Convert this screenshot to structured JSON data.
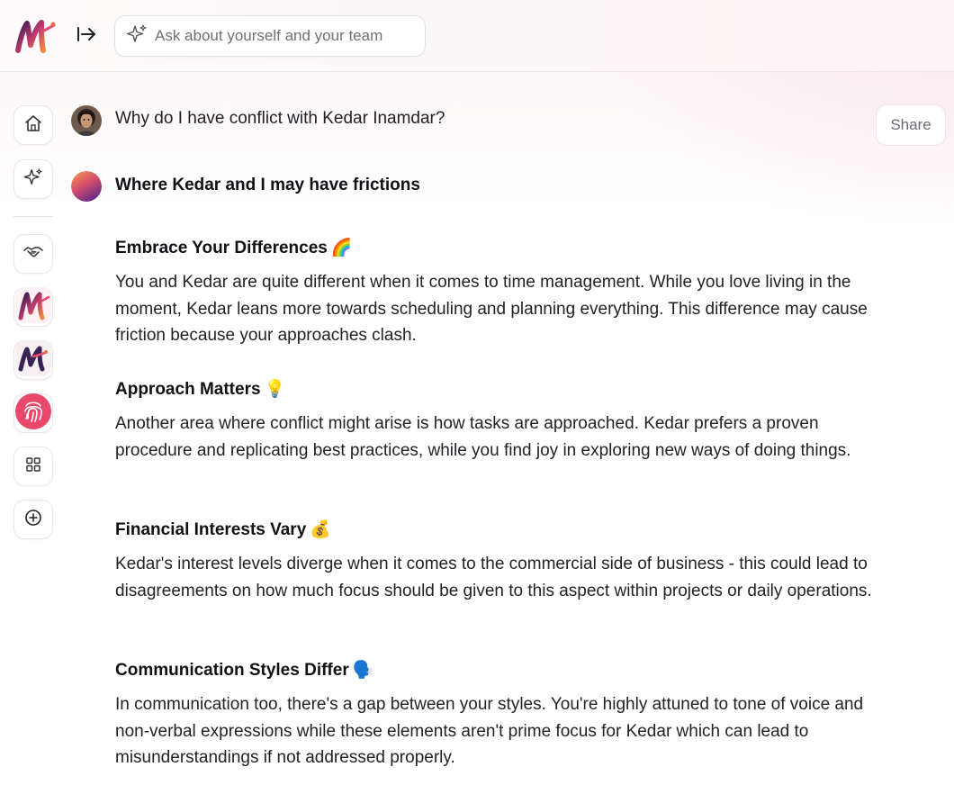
{
  "search": {
    "placeholder": "Ask about yourself and your team"
  },
  "share_label": "Share",
  "question": "Why do I have conflict with Kedar Inamdar?",
  "answer_title": "Where Kedar and I may have frictions",
  "sections": [
    {
      "heading": "Embrace Your Differences",
      "emoji": "🌈",
      "body": "You and Kedar are quite different when it comes to time management. While you love living in the moment, Kedar leans more towards scheduling and planning everything. This difference may cause friction because your approaches clash."
    },
    {
      "heading": "Approach Matters",
      "emoji": "💡",
      "body": "Another area where conflict might arise is how tasks are approached. Kedar prefers a proven procedure and replicating best practices, while you find joy in exploring new ways of doing things."
    },
    {
      "heading": "Financial Interests Vary",
      "emoji": "💰",
      "body": "Kedar's interest levels diverge when it comes to the commercial side of business - this could lead to disagreements on how much focus should be given to this aspect within projects or daily operations."
    },
    {
      "heading": "Communication Styles Differ",
      "emoji": "🗣️",
      "body": "In communication too, there's a gap between your styles. You're highly attuned to tone of voice and non-verbal expressions while these elements aren't prime focus for Kedar which can lead to misunderstandings if not addressed properly."
    }
  ],
  "icons": {
    "logo": "app-logo",
    "collapse": "arrow-right-to-bar-icon",
    "search": "sparkle-icon",
    "sidebar": [
      "home-icon",
      "sparkle-icon",
      "handshake-icon",
      "app-logo-icon",
      "app-logo-alt-icon",
      "fingerprint-icon",
      "grid-icon",
      "plus-circle-icon"
    ]
  },
  "colors": {
    "brand_pink": "#e84a6f",
    "brand_purple": "#3b2463",
    "assistant_gradient_start": "#f6a04d",
    "assistant_gradient_end": "#7a2a86"
  }
}
